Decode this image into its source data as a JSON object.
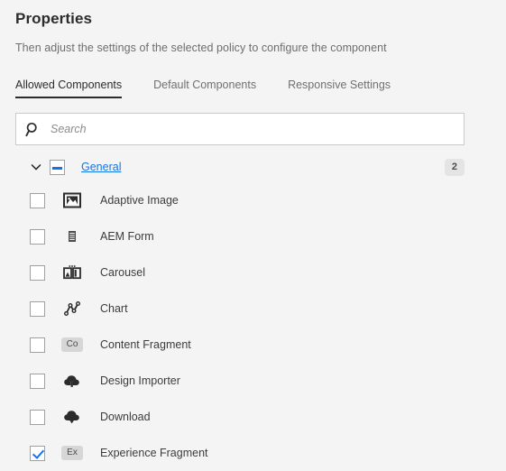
{
  "header": {
    "title": "Properties",
    "subtitle": "Then adjust the settings of the selected policy to configure the component"
  },
  "tabs": [
    {
      "label": "Allowed Components",
      "active": true
    },
    {
      "label": "Default Components",
      "active": false
    },
    {
      "label": "Responsive Settings",
      "active": false
    }
  ],
  "search": {
    "placeholder": "Search",
    "value": "",
    "icon": "search-icon"
  },
  "group": {
    "label": "General",
    "count": "2",
    "expanded": true,
    "checkbox_state": "indeterminate",
    "chevron_icon": "chevron-down-icon"
  },
  "components": [
    {
      "label": "Adaptive Image",
      "icon": "adaptive-image-icon",
      "checked": false
    },
    {
      "label": "AEM Form",
      "icon": "aem-form-icon",
      "checked": false
    },
    {
      "label": "Carousel",
      "icon": "carousel-icon",
      "checked": false
    },
    {
      "label": "Chart",
      "icon": "chart-icon",
      "checked": false
    },
    {
      "label": "Content Fragment",
      "icon": "content-fragment-icon",
      "checked": false,
      "icon_text": "Co"
    },
    {
      "label": "Design Importer",
      "icon": "design-importer-icon",
      "checked": false
    },
    {
      "label": "Download",
      "icon": "download-icon",
      "checked": false
    },
    {
      "label": "Experience Fragment",
      "icon": "experience-fragment-icon",
      "checked": true,
      "icon_text": "Ex"
    }
  ],
  "colors": {
    "background": "#f4f4f4",
    "accent": "#1473e6",
    "text": "#2c2c2c",
    "muted": "#6e6e6e",
    "badge_bg": "#e4e4e4"
  }
}
